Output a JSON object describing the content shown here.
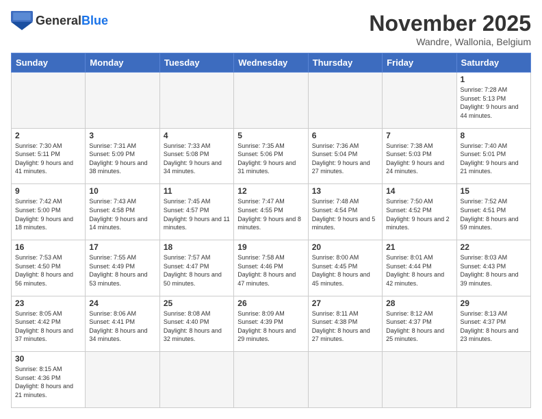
{
  "header": {
    "logo_general": "General",
    "logo_blue": "Blue",
    "month_title": "November 2025",
    "subtitle": "Wandre, Wallonia, Belgium"
  },
  "days_of_week": [
    "Sunday",
    "Monday",
    "Tuesday",
    "Wednesday",
    "Thursday",
    "Friday",
    "Saturday"
  ],
  "weeks": [
    [
      {
        "num": "",
        "info": ""
      },
      {
        "num": "",
        "info": ""
      },
      {
        "num": "",
        "info": ""
      },
      {
        "num": "",
        "info": ""
      },
      {
        "num": "",
        "info": ""
      },
      {
        "num": "",
        "info": ""
      },
      {
        "num": "1",
        "info": "Sunrise: 7:28 AM\nSunset: 5:13 PM\nDaylight: 9 hours and 44 minutes."
      }
    ],
    [
      {
        "num": "2",
        "info": "Sunrise: 7:30 AM\nSunset: 5:11 PM\nDaylight: 9 hours and 41 minutes."
      },
      {
        "num": "3",
        "info": "Sunrise: 7:31 AM\nSunset: 5:09 PM\nDaylight: 9 hours and 38 minutes."
      },
      {
        "num": "4",
        "info": "Sunrise: 7:33 AM\nSunset: 5:08 PM\nDaylight: 9 hours and 34 minutes."
      },
      {
        "num": "5",
        "info": "Sunrise: 7:35 AM\nSunset: 5:06 PM\nDaylight: 9 hours and 31 minutes."
      },
      {
        "num": "6",
        "info": "Sunrise: 7:36 AM\nSunset: 5:04 PM\nDaylight: 9 hours and 27 minutes."
      },
      {
        "num": "7",
        "info": "Sunrise: 7:38 AM\nSunset: 5:03 PM\nDaylight: 9 hours and 24 minutes."
      },
      {
        "num": "8",
        "info": "Sunrise: 7:40 AM\nSunset: 5:01 PM\nDaylight: 9 hours and 21 minutes."
      }
    ],
    [
      {
        "num": "9",
        "info": "Sunrise: 7:42 AM\nSunset: 5:00 PM\nDaylight: 9 hours and 18 minutes."
      },
      {
        "num": "10",
        "info": "Sunrise: 7:43 AM\nSunset: 4:58 PM\nDaylight: 9 hours and 14 minutes."
      },
      {
        "num": "11",
        "info": "Sunrise: 7:45 AM\nSunset: 4:57 PM\nDaylight: 9 hours and 11 minutes."
      },
      {
        "num": "12",
        "info": "Sunrise: 7:47 AM\nSunset: 4:55 PM\nDaylight: 9 hours and 8 minutes."
      },
      {
        "num": "13",
        "info": "Sunrise: 7:48 AM\nSunset: 4:54 PM\nDaylight: 9 hours and 5 minutes."
      },
      {
        "num": "14",
        "info": "Sunrise: 7:50 AM\nSunset: 4:52 PM\nDaylight: 9 hours and 2 minutes."
      },
      {
        "num": "15",
        "info": "Sunrise: 7:52 AM\nSunset: 4:51 PM\nDaylight: 8 hours and 59 minutes."
      }
    ],
    [
      {
        "num": "16",
        "info": "Sunrise: 7:53 AM\nSunset: 4:50 PM\nDaylight: 8 hours and 56 minutes."
      },
      {
        "num": "17",
        "info": "Sunrise: 7:55 AM\nSunset: 4:49 PM\nDaylight: 8 hours and 53 minutes."
      },
      {
        "num": "18",
        "info": "Sunrise: 7:57 AM\nSunset: 4:47 PM\nDaylight: 8 hours and 50 minutes."
      },
      {
        "num": "19",
        "info": "Sunrise: 7:58 AM\nSunset: 4:46 PM\nDaylight: 8 hours and 47 minutes."
      },
      {
        "num": "20",
        "info": "Sunrise: 8:00 AM\nSunset: 4:45 PM\nDaylight: 8 hours and 45 minutes."
      },
      {
        "num": "21",
        "info": "Sunrise: 8:01 AM\nSunset: 4:44 PM\nDaylight: 8 hours and 42 minutes."
      },
      {
        "num": "22",
        "info": "Sunrise: 8:03 AM\nSunset: 4:43 PM\nDaylight: 8 hours and 39 minutes."
      }
    ],
    [
      {
        "num": "23",
        "info": "Sunrise: 8:05 AM\nSunset: 4:42 PM\nDaylight: 8 hours and 37 minutes."
      },
      {
        "num": "24",
        "info": "Sunrise: 8:06 AM\nSunset: 4:41 PM\nDaylight: 8 hours and 34 minutes."
      },
      {
        "num": "25",
        "info": "Sunrise: 8:08 AM\nSunset: 4:40 PM\nDaylight: 8 hours and 32 minutes."
      },
      {
        "num": "26",
        "info": "Sunrise: 8:09 AM\nSunset: 4:39 PM\nDaylight: 8 hours and 29 minutes."
      },
      {
        "num": "27",
        "info": "Sunrise: 8:11 AM\nSunset: 4:38 PM\nDaylight: 8 hours and 27 minutes."
      },
      {
        "num": "28",
        "info": "Sunrise: 8:12 AM\nSunset: 4:37 PM\nDaylight: 8 hours and 25 minutes."
      },
      {
        "num": "29",
        "info": "Sunrise: 8:13 AM\nSunset: 4:37 PM\nDaylight: 8 hours and 23 minutes."
      }
    ],
    [
      {
        "num": "30",
        "info": "Sunrise: 8:15 AM\nSunset: 4:36 PM\nDaylight: 8 hours and 21 minutes."
      },
      {
        "num": "",
        "info": ""
      },
      {
        "num": "",
        "info": ""
      },
      {
        "num": "",
        "info": ""
      },
      {
        "num": "",
        "info": ""
      },
      {
        "num": "",
        "info": ""
      },
      {
        "num": "",
        "info": ""
      }
    ]
  ]
}
